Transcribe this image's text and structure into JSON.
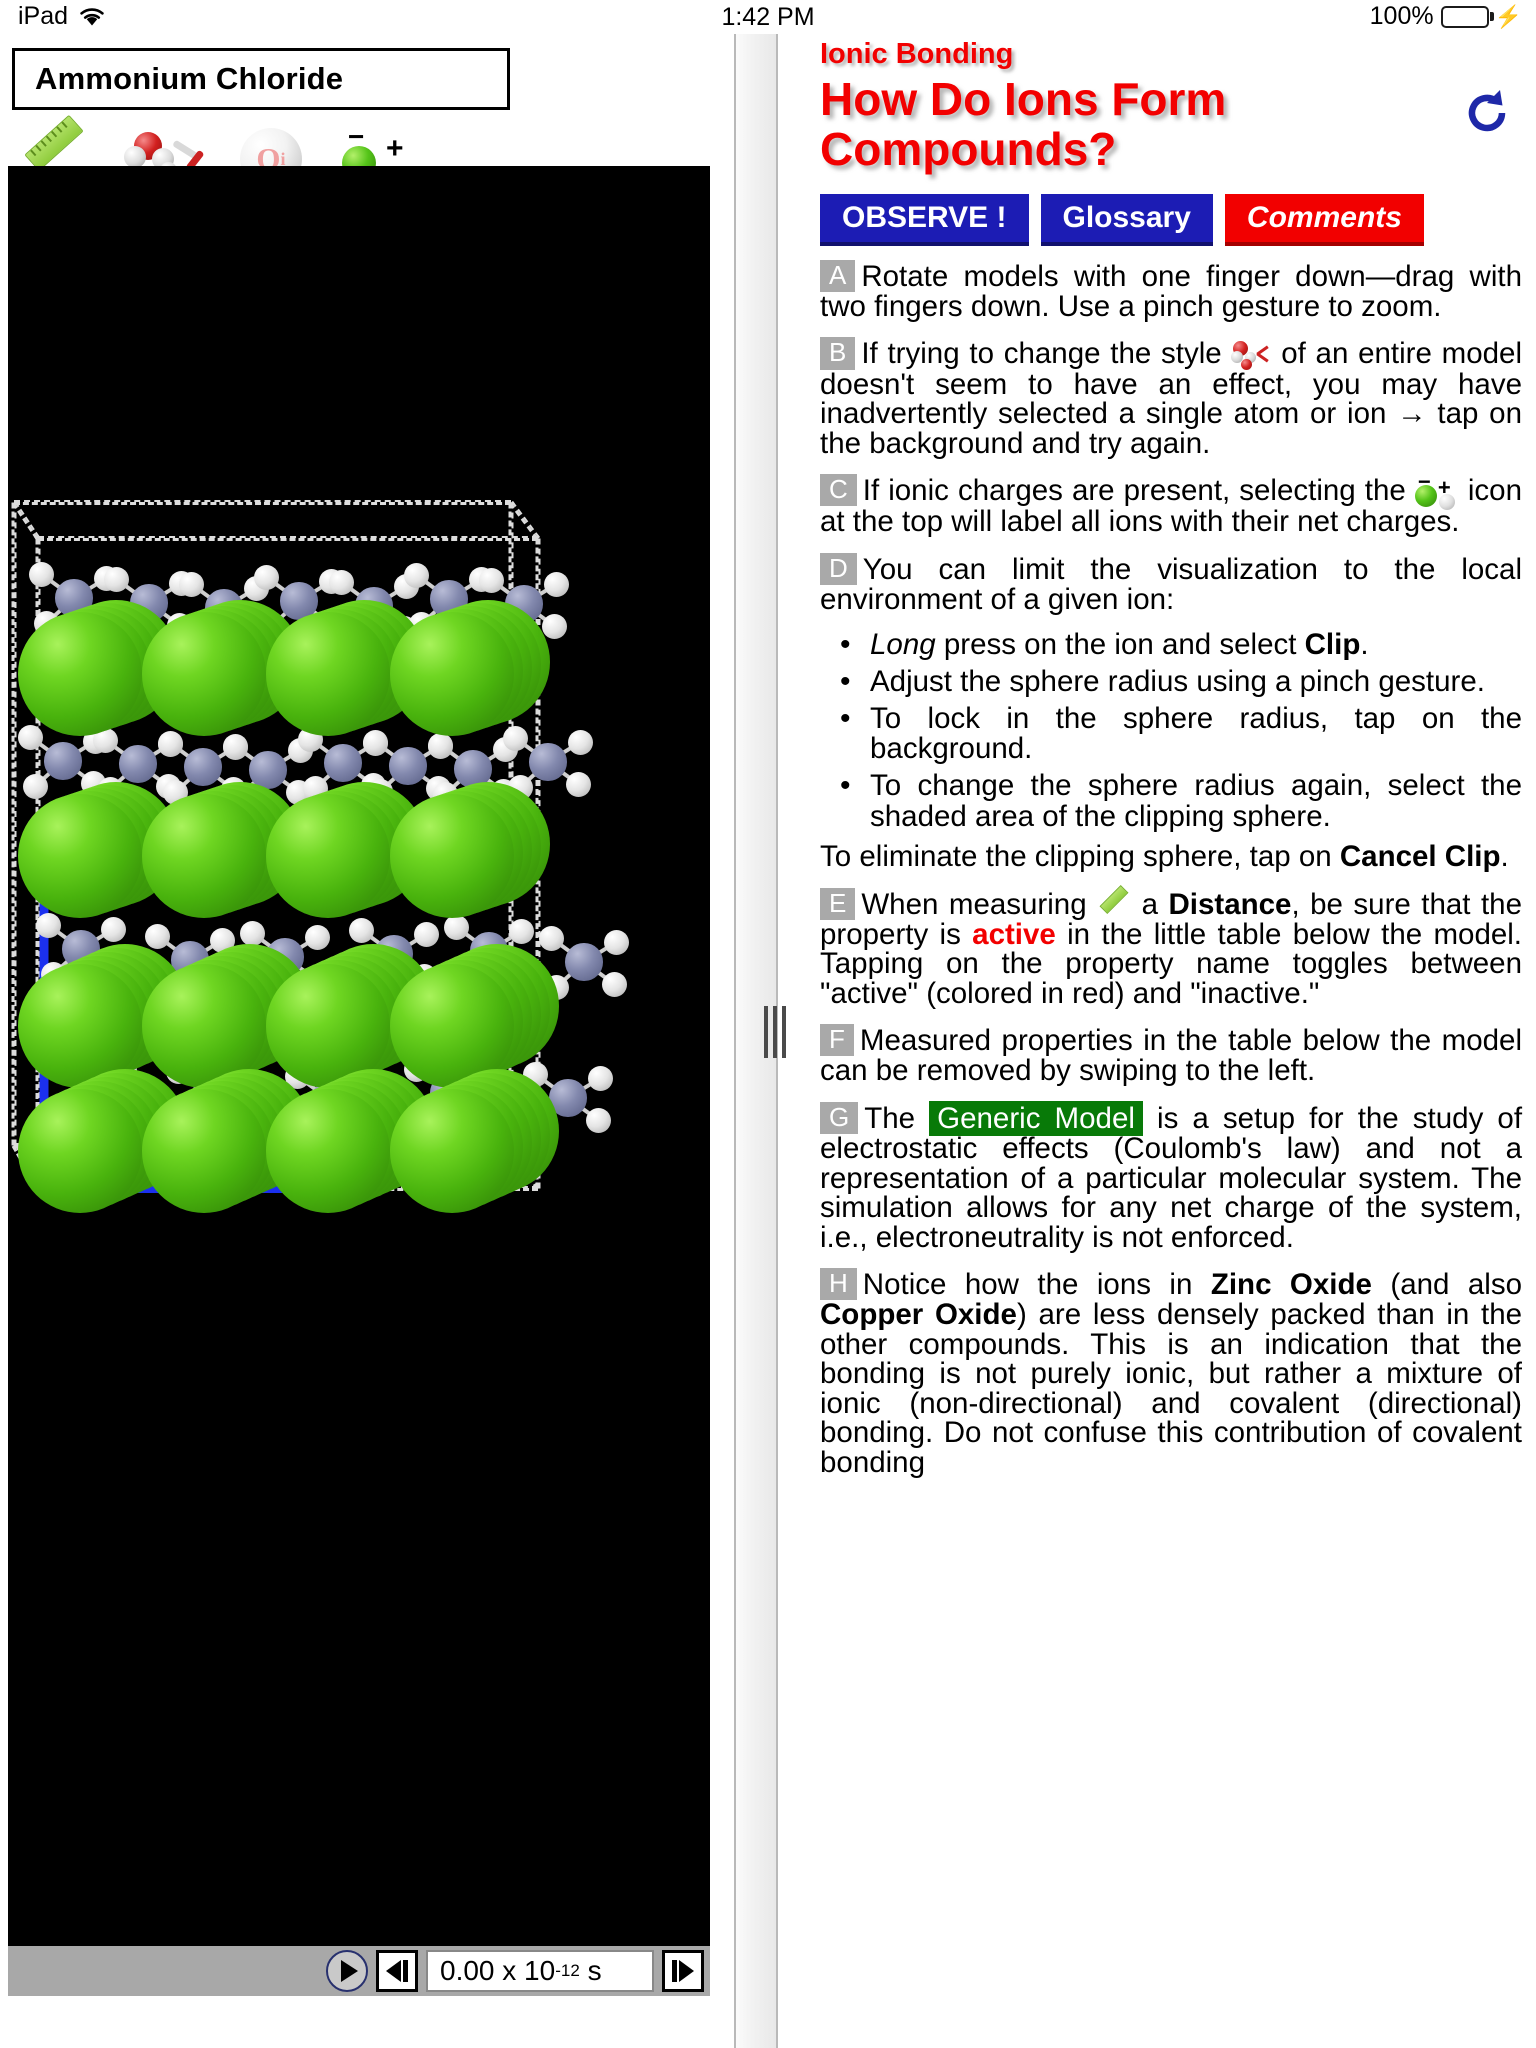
{
  "status_bar": {
    "device": "iPad",
    "wifi_icon": "wifi-icon",
    "time": "1:42 PM",
    "battery_percent": "100%",
    "battery_icon": "battery-full-charging-icon"
  },
  "left_panel": {
    "model_title": "Ammonium Chloride",
    "toolbar": [
      {
        "name": "measure-ruler-icon",
        "label": "Measure distance"
      },
      {
        "name": "model-style-icon",
        "label": "Change model style"
      },
      {
        "name": "charge-qi-icon",
        "label": "Qi"
      },
      {
        "name": "ion-charge-icon",
        "label": "Label ion charges"
      }
    ],
    "player": {
      "play_label": "Play",
      "step_back_label": "Step back",
      "step_forward_label": "Step forward",
      "time_value": "0.00 x 10",
      "time_exponent": "-12",
      "time_unit": "s"
    }
  },
  "splitter": {
    "grip_icon": "drag-handle-icon"
  },
  "right_panel": {
    "kicker": "Ionic Bonding",
    "headline": "How Do Ions Form Compounds?",
    "reload_icon": "reload-icon",
    "buttons": [
      {
        "label": "OBSERVE !",
        "style": "blue"
      },
      {
        "label": "Glossary",
        "style": "blue"
      },
      {
        "label": "Comments",
        "style": "red"
      }
    ],
    "paragraphs": [
      {
        "tag": "A",
        "text": "Rotate models with one finger down—drag with two fingers down. Use a pinch gesture to zoom."
      },
      {
        "tag": "B",
        "text_before_icon": "If trying to change the style ",
        "icon": "model-style-icon",
        "text_after_icon": " of an entire model doesn't seem to have an effect, you may have inadvertently selected a single atom or ion → tap on the background and try again."
      },
      {
        "tag": "C",
        "text_before_icon": "If ionic charges are present, selecting the ",
        "icon": "ion-charge-icon",
        "text_after_icon": " icon at the top will label all ions with their net charges."
      },
      {
        "tag": "D",
        "text": "You can limit the visualization to the local environment of a given ion:",
        "bullets": [
          {
            "italic_lead": "Long",
            "text": " press on the ion and select ",
            "bold_tail": "Clip",
            "tail": "."
          },
          {
            "text": "Adjust the sphere radius using a pinch gesture."
          },
          {
            "text": "To lock in the sphere radius, tap on the background."
          },
          {
            "text": "To change the sphere radius again, select the shaded area of the clipping sphere."
          }
        ],
        "closing_before": "To eliminate the clipping sphere, tap on ",
        "closing_bold": "Cancel Clip",
        "closing_after": "."
      },
      {
        "tag": "E",
        "seg1": "When measuring ",
        "icon": "measure-ruler-icon",
        "seg2": " a ",
        "bold1": "Distance",
        "seg3": ", be sure that the property is ",
        "red1": "active",
        "seg4": " in the little table below the model. Tapping on the property name toggles between \"active\" (colored in red) and \"inactive.\""
      },
      {
        "tag": "F",
        "text": "Measured properties in the table below the model can be removed by swiping to the left."
      },
      {
        "tag": "G",
        "seg1": "The ",
        "highlight": "Generic Model",
        "seg2": " is a setup for the study of electrostatic effects (Coulomb's law) and not a representation of a particular molecular system. The simulation allows for any net charge of the system, i.e., electroneutrality is not enforced."
      },
      {
        "tag": "H",
        "seg1": "Notice how the ions in ",
        "bold1": "Zinc Oxide",
        "seg2": " (and also ",
        "bold2": "Copper Oxide",
        "seg3": ") are less densely packed than in the other compounds. This is an indication that the bonding is not purely ionic, but rather a mixture of ionic (non-directional) and covalent (directional) bonding. Do not confuse this contribution of covalent bonding"
      }
    ]
  },
  "colors": {
    "accent_red": "#f20000",
    "button_blue": "#1c1cb4",
    "tag_grey": "#a9a9a9",
    "highlight_green": "#087a08",
    "chloride_green": "#6fd622",
    "nitrogen_blue": "#8288ad",
    "axis_blue": "#1b30ef"
  }
}
